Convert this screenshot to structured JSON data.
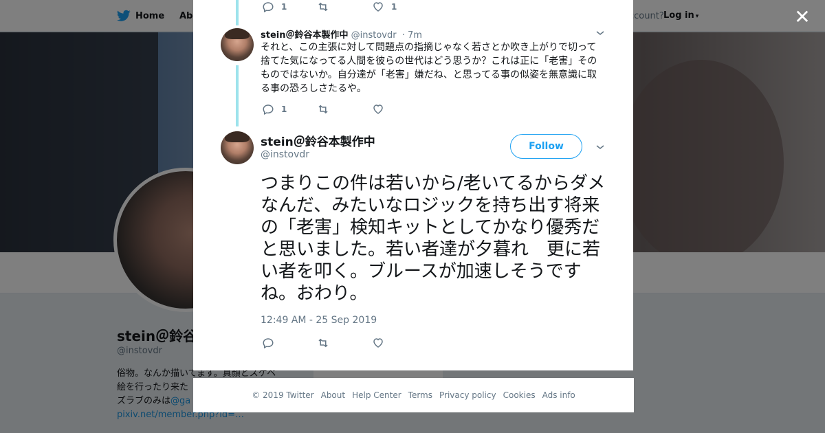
{
  "topbar": {
    "home_label": "Home",
    "about_label": "Abo",
    "account_prompt": "ccount?",
    "login_label": "Log in"
  },
  "profile": {
    "name": "stein＠鈴谷",
    "handle": "@instovdr",
    "bio_line1": "俗物。なんか描いてます。真顔とスケベ",
    "bio_line2": "絵を行ったり来た",
    "bio_line3_prefix": "ズラブのみは",
    "bio_line3_link": "@ga",
    "bio_line4_link": "pixiv.net/member.php?id=…",
    "card_text": "Ads info"
  },
  "modal": {
    "close_label": "✕",
    "tweet_prev_actions": {
      "reply_count": "1",
      "retweet_count": "",
      "like_count": "1"
    },
    "tweet1": {
      "name": "stein＠鈴谷本製作中",
      "handle": "@instovdr",
      "time": "· 7m",
      "text": "それと、この主張に対して問題点の指摘じゃなく若さとか吹き上がりで切って捨てた気になってる人間を彼らの世代はどう思うか？これは正に「老害」そのものではないか。自分達が「老害」嫌だね、と思ってる事の似姿を無意識に取る事の恐ろしさたるや。",
      "reply_count": "1"
    },
    "tweet2": {
      "name": "stein＠鈴谷本製作中",
      "handle": "@instovdr",
      "follow_label": "Follow",
      "text": "つまりこの件は若いから/老いてるからダメなんだ、みたいなロジックを持ち出す将来の「老害」検知キットとしてかなり優秀だと思いました。若い者達が夕暮れ　更に若い者を叩く。ブルースが加速しそうですね。おわり。",
      "date": "12:49 AM - 25 Sep 2019"
    }
  },
  "footer": {
    "copyright": "© 2019 Twitter",
    "links": [
      "About",
      "Help Center",
      "Terms",
      "Privacy policy",
      "Cookies",
      "Ads info"
    ]
  },
  "colors": {
    "accent": "#1da1f2",
    "thread_line": "#9de3ec",
    "text_secondary": "#657786"
  }
}
